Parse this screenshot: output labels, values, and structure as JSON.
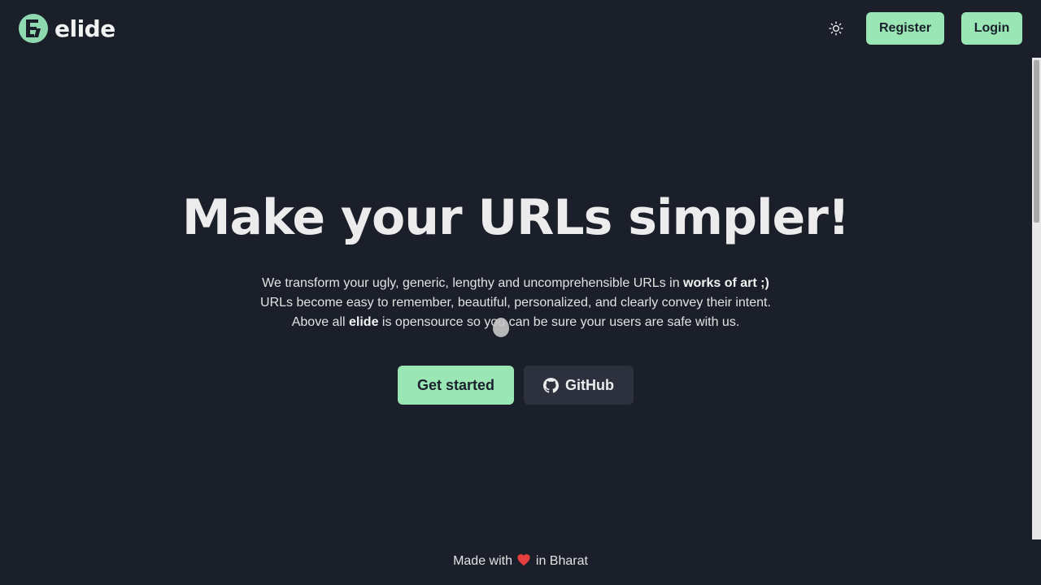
{
  "header": {
    "logo_text": "elide",
    "logo_initial": "E",
    "register_label": "Register",
    "login_label": "Login",
    "theme_icon": "sun-icon"
  },
  "hero": {
    "title": "Make your URLs simpler!",
    "line1_prefix": "We transform your ugly, generic, lengthy and uncomprehensible URLs in ",
    "line1_bold": "works of art ;)",
    "line2": "URLs become easy to remember, beautiful, personalized, and clearly convey their intent.",
    "line3_prefix": "Above all ",
    "line3_bold": "elide",
    "line3_suffix": " is opensource so you can be sure your users are safe with us.",
    "get_started_label": "Get started",
    "github_label": "GitHub"
  },
  "footer": {
    "prefix": "Made with",
    "suffix": "in Bharat",
    "heart_icon": "heart-icon"
  },
  "colors": {
    "background": "#1b1f2a",
    "accent": "#9ae6b4",
    "secondary_button": "#2d313d",
    "heart": "#e53e3e"
  }
}
